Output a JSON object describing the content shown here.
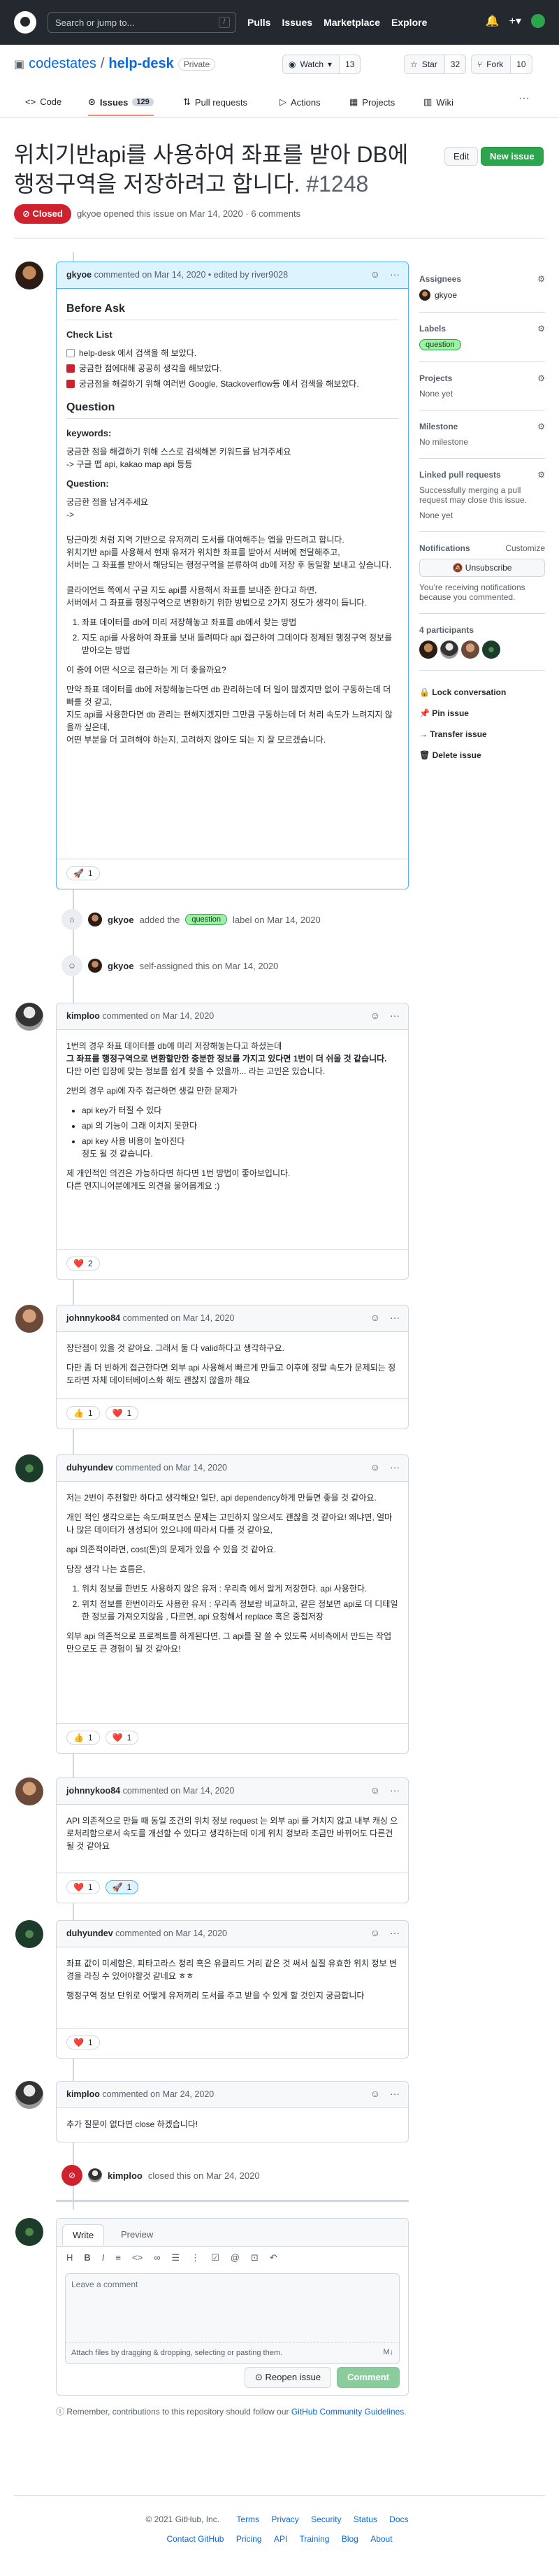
{
  "header": {
    "search_placeholder": "Search or jump to...",
    "search_key": "/",
    "nav": [
      "Pulls",
      "Issues",
      "Marketplace",
      "Explore"
    ]
  },
  "repo": {
    "owner": "codestates",
    "name": "help-desk",
    "visibility": "Private",
    "watch_label": "Watch",
    "watch_count": "13",
    "star_label": "Star",
    "star_count": "32",
    "fork_label": "Fork",
    "fork_count": "10"
  },
  "tabs": [
    {
      "label": "Code"
    },
    {
      "label": "Issues",
      "count": "129"
    },
    {
      "label": "Pull requests"
    },
    {
      "label": "Actions"
    },
    {
      "label": "Projects"
    },
    {
      "label": "Wiki"
    }
  ],
  "issue": {
    "title": "위치기반api를 사용하여 좌표를 받아 DB에 행정구역을 저장하려고 합니다.",
    "number": "#1248",
    "state": "Closed",
    "meta": "gkyoe opened this issue on Mar 14, 2020 · 6 comments",
    "edit_label": "Edit",
    "new_issue_label": "New issue"
  },
  "sidebar": {
    "assignees_title": "Assignees",
    "assignee": "gkyoe",
    "labels_title": "Labels",
    "label": "question",
    "projects_title": "Projects",
    "projects_value": "None yet",
    "milestone_title": "Milestone",
    "milestone_value": "No milestone",
    "linked_title": "Linked pull requests",
    "linked_value": "Successfully merging a pull request may close this issue.",
    "linked_value2": "None yet",
    "notifications_title": "Notifications",
    "customize": "Customize",
    "unsubscribe": "Unsubscribe",
    "notif_text": "You’re receiving notifications because you commented.",
    "participants": "4 participants",
    "lock": "Lock conversation",
    "pin": "Pin issue",
    "transfer": "Transfer issue",
    "delete": "Delete issue"
  },
  "comments": [
    {
      "author": "gkyoe",
      "meta": "commented on Mar 14, 2020 • edited by river9028",
      "before_ask": "Before Ask",
      "checklist_title": "Check List",
      "checklist": [
        "help-desk 에서 검색을 해 보았다.",
        "궁금한 점에대해 공공히 생각을 해보았다.",
        "궁금점을 해결하기 위해 여러번 Google, Stackoverflow등 에서 검색을 해보았다."
      ],
      "question_h": "Question",
      "keywords_h": "keywords:",
      "keywords_1": "궁금한 점을 해결하기 위해 스스로 검색해본 키워드를 남겨주세요",
      "keywords_2": "-> 구글 맵 api, kakao map api 등등",
      "question2_h": "Question:",
      "q1": "궁금한 점을 남겨주세요",
      "q2": "->",
      "p1": "당근마켓 처럼 지역 기반으로 유저끼리 도서를 대여해주는 앱을 만드려고 합니다.",
      "p2": "위치기반 api를 사용해서 현재 유저가 위치한 좌표를 받아서 서버에 전달해주고,",
      "p3": "서버는 그 좌표를 받아서 해당되는 행정구역을 분류하여 db에 저장 후 동일할 보내고 싶습니다.",
      "p4": "클라이언트 쪽에서 구글 지도 api를 사용해서 좌표를 보내준 한다고 하면,",
      "p5": "서버에서 그 좌표를 행정구역으로 변환하기 위한 방법으로 2가지 정도가 생각이 듭니다.",
      "list": [
        "좌표 데이터를 db에 미리 저장해놓고 좌표를 db에서 찾는 방법",
        "지도 api를 사용하여 좌표를 보내 돌려따다 api 접근하여 그데이다 정제된 행정구역 정보를 받아오는 방법"
      ],
      "p6": "이 중에 어떤 식으로 접근하는 게 더 좋을까요?",
      "p7": "만약 좌표 데이터를 db에 저장해놓는다면 db 관리하는데 더 일이 많겠지만 없이 구동하는데 더 빠를 것 같고,",
      "p8": "지도 api를 사용한다면 db 관리는 편해지겠지만 그만큼 구동하는데 더 처리 속도가 느려지지 않을까 싶은데,",
      "p9": "어떤 부분을 더 고려해야 하는지, 고려하지 않아도 되는 지 잘 모르겠습니다.",
      "reaction": "1"
    },
    {
      "author": "kimploo",
      "meta": "commented on Mar 14, 2020",
      "p1": "1번의 경우 좌표 데이터를 db에 미리 저장해놓는다고 하셨는데",
      "p2": "그 좌표를 행정구역으로 변환할만한 충분한 정보를 가지고 있다면 1번이 더 쉬울 것 같습니다.",
      "p3": "다만 이런 입장에 맞는 정보를 쉽게 찾을 수 있을까... 라는 고민은 있습니다.",
      "p4": "2번의 경우 api에 자주 접근하면 생길 만한 문제가",
      "list": [
        "api key가 터질 수 있다",
        "api 의 기능이 그래 이치지 못한다",
        "api key 사용 비용이 높아진다"
      ],
      "list_sub": "정도 될 것 같습니다.",
      "p5": "제 개인적인 의견은 가능하다면 하다면 1번 방법이 좋아보입니다.",
      "p6": "다른 엔지니어분에게도 의견을 물어봅게요 :)",
      "reaction": "2"
    },
    {
      "author": "johnnykoo84",
      "meta": "commented on Mar 14, 2020",
      "p1": "장단점이 있을 것 같아요. 그래서 둘 다 valid하다고 생각하구요.",
      "p2": "다만 좀 더 빈하게 접근한다면 외부 api 사용해서 빠르게 만들고 이후에 정말 속도가 문제되는 정도라면 자체 데이터베이스화 해도 괜찮지 않을까 해요",
      "reaction1": "1",
      "reaction2": "1"
    },
    {
      "author": "duhyundev",
      "meta": "commented on Mar 14, 2020",
      "p1": "저는 2번이 추천할만 하다고 생각해요! 일단, api dependency하게 만들면 좋을 것 같아요.",
      "p2": "개인 적인 생각으로는 속도/퍼포먼스 문제는 고민하지 않으셔도 괜찮을 것 같아요! 왜냐면, 얼마나 많은 데이터가 생성되어 있으냐에 따라서 다를 것 같아요,",
      "p3": "api 의존적이라면, cost(돈)의 문제가 있을 수 있을 것 같아요.",
      "p4": "당장 생각 나는 흐름은,",
      "list": [
        "위치 정보를 한번도 사용하지 않은 유저 : 우리측 에서 알게 저장한다. api 사용한다.",
        "위치 정보를 한번이라도 사용한 유저 : 우리측 정보랑 비교하고, 같은 정보면 api로 더 디테일한 정보를 가져오지않음 , 다르면, api 요청해서 replace 혹은 중첩저장"
      ],
      "p5": "외부 api 의존적으로 프로젝트를 하게된다면, 그 api를 잘 쓸 수 있도록 서비측에서 만드는 작업만으로도 큰 경험이 될 것 같아요!",
      "reaction1": "1",
      "reaction2": "1"
    },
    {
      "author": "johnnykoo84",
      "meta": "commented on Mar 14, 2020",
      "p1": "API 의존적으로 만들 때 동일 조건의 위치 정보 request 는 외부 api 를 거치지 않고 내부 캐싱 으로처리함으로서 속도를 개선할 수 있다고 생각하는데 이게 위치 정보라 조금만 바뀌어도 다른건 될 것 같아요",
      "reaction1": "1",
      "reaction2": "1"
    },
    {
      "author": "duhyundev",
      "meta": "commented on Mar 14, 2020",
      "p1": "좌표 값이 미세함은, 피타고라스 정리 혹은 유클리드 거리 같은 것 써서 실질 유효한 위치 정보 변경을 라칭 수 있어야할것 같네요 ㅎㅎ",
      "p2": "행정구역 정보 단위로 어떻게 유저끼리 도서를 주고 받을 수 있게 할 것인지 궁금합니다",
      "reaction": "1"
    },
    {
      "author": "kimploo",
      "meta": "commented on Mar 24, 2020",
      "p1": "추가 질문이 없다면 close 하겠습니다!"
    }
  ],
  "events": {
    "labeled_actor": "gkyoe",
    "labeled_text1": "added the",
    "labeled_label": "question",
    "labeled_text2": "label on Mar 14, 2020",
    "assigned_actor": "gkyoe",
    "assigned_text": "self-assigned this on Mar 14, 2020",
    "closed_actor": "kimploo",
    "closed_text": "closed this on Mar 24, 2020"
  },
  "composer": {
    "tab_write": "Write",
    "tab_preview": "Preview",
    "placeholder": "Leave a comment",
    "attach": "Attach files by dragging & dropping, selecting or pasting them.",
    "reopen": "Reopen issue",
    "comment": "Comment",
    "remember_pre": "Remember, contributions to this repository should follow our",
    "remember_link": "GitHub Community Guidelines",
    "remember_post": "."
  },
  "footer": {
    "copyright": "© 2021 GitHub, Inc.",
    "row1": [
      "Terms",
      "Privacy",
      "Security",
      "Status",
      "Docs"
    ],
    "row2": [
      "Contact GitHub",
      "Pricing",
      "API",
      "Training",
      "Blog",
      "About"
    ]
  }
}
